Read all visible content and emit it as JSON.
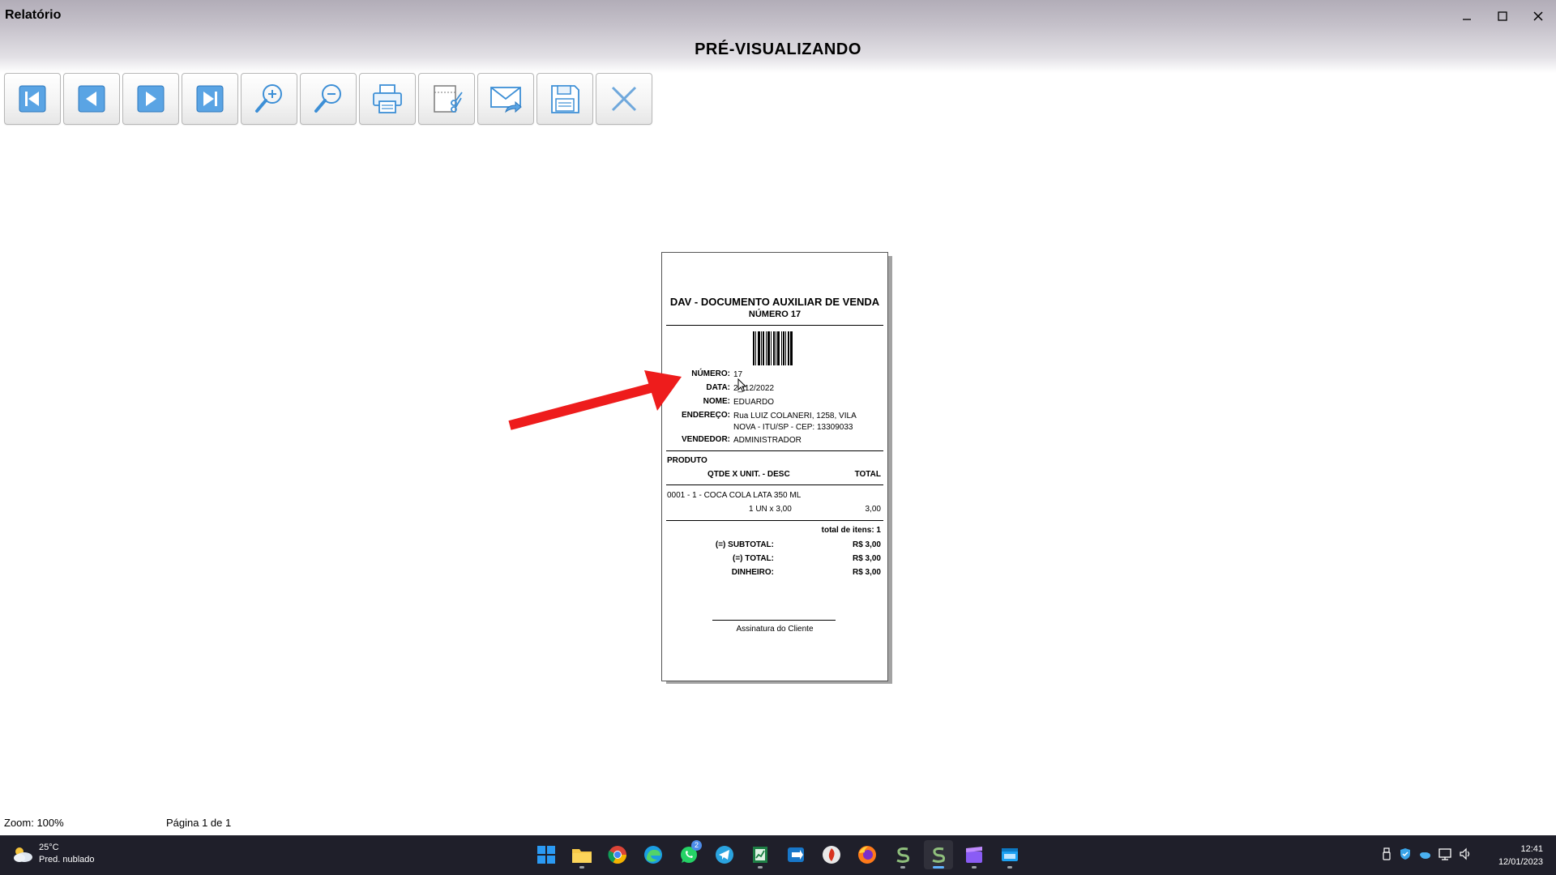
{
  "window": {
    "title": "Relatório",
    "heading": "PRÉ-VISUALIZANDO"
  },
  "toolbar": [
    {
      "name": "first-page",
      "icon": "first-page-icon"
    },
    {
      "name": "previous-page",
      "icon": "previous-page-icon"
    },
    {
      "name": "next-page",
      "icon": "next-page-icon"
    },
    {
      "name": "last-page",
      "icon": "last-page-icon"
    },
    {
      "name": "zoom-in",
      "icon": "zoom-in-icon"
    },
    {
      "name": "zoom-out",
      "icon": "zoom-out-icon"
    },
    {
      "name": "print",
      "icon": "printer-icon"
    },
    {
      "name": "page-setup",
      "icon": "page-setup-icon"
    },
    {
      "name": "send-email",
      "icon": "email-icon"
    },
    {
      "name": "save",
      "icon": "floppy-disk-icon"
    },
    {
      "name": "close",
      "icon": "close-x-icon"
    }
  ],
  "report": {
    "title": "DAV - DOCUMENTO AUXILIAR DE VENDA",
    "subtitle": "NÚMERO 17",
    "fields": {
      "numero_label": "NÚMERO:",
      "numero": "17",
      "data_label": "DATA:",
      "data": "2_/12/2022",
      "nome_label": "NOME:",
      "nome": "EDUARDO",
      "endereco_label": "ENDEREÇO:",
      "endereco": "Rua LUIZ COLANERI, 1258, VILA NOVA - ITU/SP - CEP: 13309033",
      "vendedor_label": "VENDEDOR:",
      "vendedor": "ADMINISTRADOR"
    },
    "produto_header": "PRODUTO",
    "col_qtde": "QTDE X UNIT. - DESC",
    "col_total": "TOTAL",
    "items": [
      {
        "desc": "0001 - 1 - COCA COLA LATA 350 ML",
        "qty_line": "1 UN x 3,00",
        "total": "3,00"
      }
    ],
    "total_itens": "total de itens: 1",
    "subtotal_label": "(=) SUBTOTAL:",
    "subtotal": "R$ 3,00",
    "total_label": "(=) TOTAL:",
    "total": "R$ 3,00",
    "dinheiro_label": "DINHEIRO:",
    "dinheiro": "R$ 3,00",
    "signature": "Assinatura do Cliente"
  },
  "status": {
    "zoom": "Zoom: 100%",
    "page": "Página 1 de 1"
  },
  "taskbar": {
    "weather_temp": "25°C",
    "weather_desc": "Pred. nublado",
    "whatsapp_badge": "2",
    "time": "12:41",
    "date": "12/01/2023"
  },
  "colors": {
    "accent_blue": "#3d8fd6",
    "arrow_red": "#ee1c1c",
    "taskbar": "#1f1f2a"
  }
}
